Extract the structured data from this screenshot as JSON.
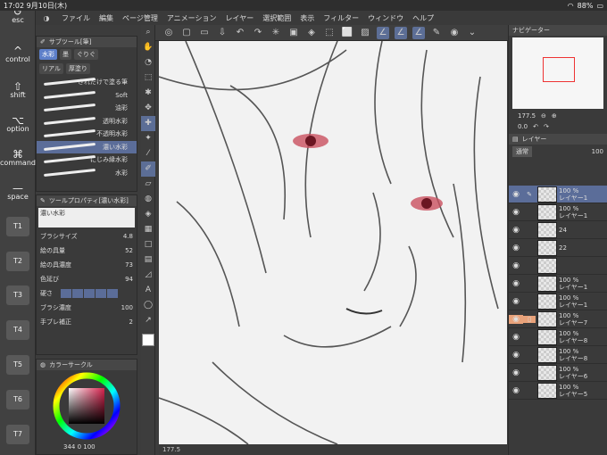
{
  "status": {
    "time": "17:02",
    "date": "9月10日(木)",
    "battery": "88%"
  },
  "menu": [
    "ファイル",
    "編集",
    "ページ管理",
    "アニメーション",
    "レイヤー",
    "選択範囲",
    "表示",
    "フィルター",
    "ウィンドウ",
    "ヘルプ"
  ],
  "keys": {
    "esc": "esc",
    "control": "control",
    "shift": "shift",
    "option": "option",
    "command": "command",
    "space": "space"
  },
  "tkeys": [
    "T1",
    "T2",
    "T3",
    "T4",
    "T5",
    "T6",
    "T7"
  ],
  "subtool": {
    "title": "サブツール[筆]",
    "tabs": [
      "水彩",
      "墨",
      "ぐりぐ",
      "リアル",
      "厚塗り"
    ],
    "brushes": [
      "されだけで塗る筆",
      "Soft",
      "油彩",
      "透明水彩",
      "不透明水彩",
      "濃い水彩",
      "にじみ縁水彩",
      "水彩"
    ]
  },
  "toolprop": {
    "title": "ツールプロパティ[濃い水彩]",
    "name": "濃い水彩",
    "props": [
      {
        "label": "ブラシサイズ",
        "value": "4.8"
      },
      {
        "label": "絵の具量",
        "value": "52"
      },
      {
        "label": "絵の具濃度",
        "value": "73"
      },
      {
        "label": "色延び",
        "value": "94"
      },
      {
        "label": "硬さ",
        "value": ""
      },
      {
        "label": "ブラシ濃度",
        "value": "100"
      },
      {
        "label": "手ブレ補正",
        "value": "2"
      }
    ]
  },
  "color": {
    "title": "カラーサークル",
    "readout": "344 0 100"
  },
  "navigator": {
    "title": "ナビゲーター",
    "zoom": "177.5",
    "angle": "0.0"
  },
  "layers": {
    "title": "レイヤー",
    "mode": "通常",
    "opacity": "100",
    "items": [
      {
        "pct": "100 %",
        "name": "レイヤー1"
      },
      {
        "pct": "100 %",
        "name": "レイヤー1"
      },
      {
        "pct": "24",
        "name": ""
      },
      {
        "pct": "22",
        "name": ""
      },
      {
        "pct": "",
        "name": ""
      },
      {
        "pct": "100 %",
        "name": "レイヤー1"
      },
      {
        "pct": "100 %",
        "name": "レイヤー1"
      },
      {
        "pct": "100 %",
        "name": "レイヤー7"
      },
      {
        "pct": "100 %",
        "name": "レイヤー8"
      },
      {
        "pct": "100 %",
        "name": "レイヤー8"
      },
      {
        "pct": "100 %",
        "name": "レイヤー6"
      },
      {
        "pct": "100 %",
        "name": "レイヤー5"
      }
    ]
  },
  "canvas_zoom": "177.5"
}
